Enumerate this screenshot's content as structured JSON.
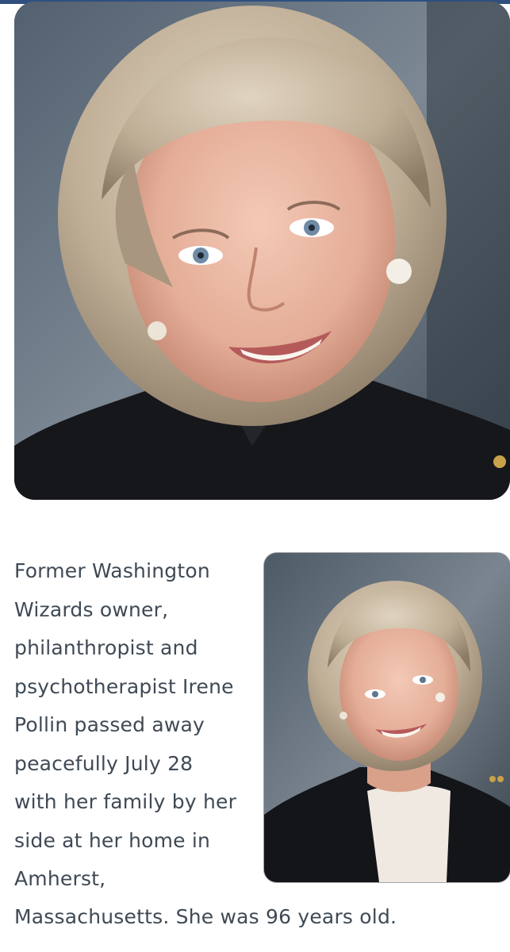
{
  "colors": {
    "accent_bar": "#2f4f7f",
    "text": "#3f4a55",
    "background": "#ffffff"
  },
  "hero_image": {
    "subject": "portrait-photo",
    "background_color": "#6d7a85"
  },
  "inline_image": {
    "subject": "portrait-photo",
    "background_color": "#6d7a85"
  },
  "article": {
    "paragraph_lines": [
      "Former Washington",
      "Wizards owner,",
      "philanthropist and",
      "psychotherapist Irene",
      "Pollin passed away",
      "peacefully July 28",
      "with her family by her",
      "side at her home in",
      "Amherst,"
    ],
    "paragraph_tail": "Massachusetts. She was 96 years old."
  }
}
